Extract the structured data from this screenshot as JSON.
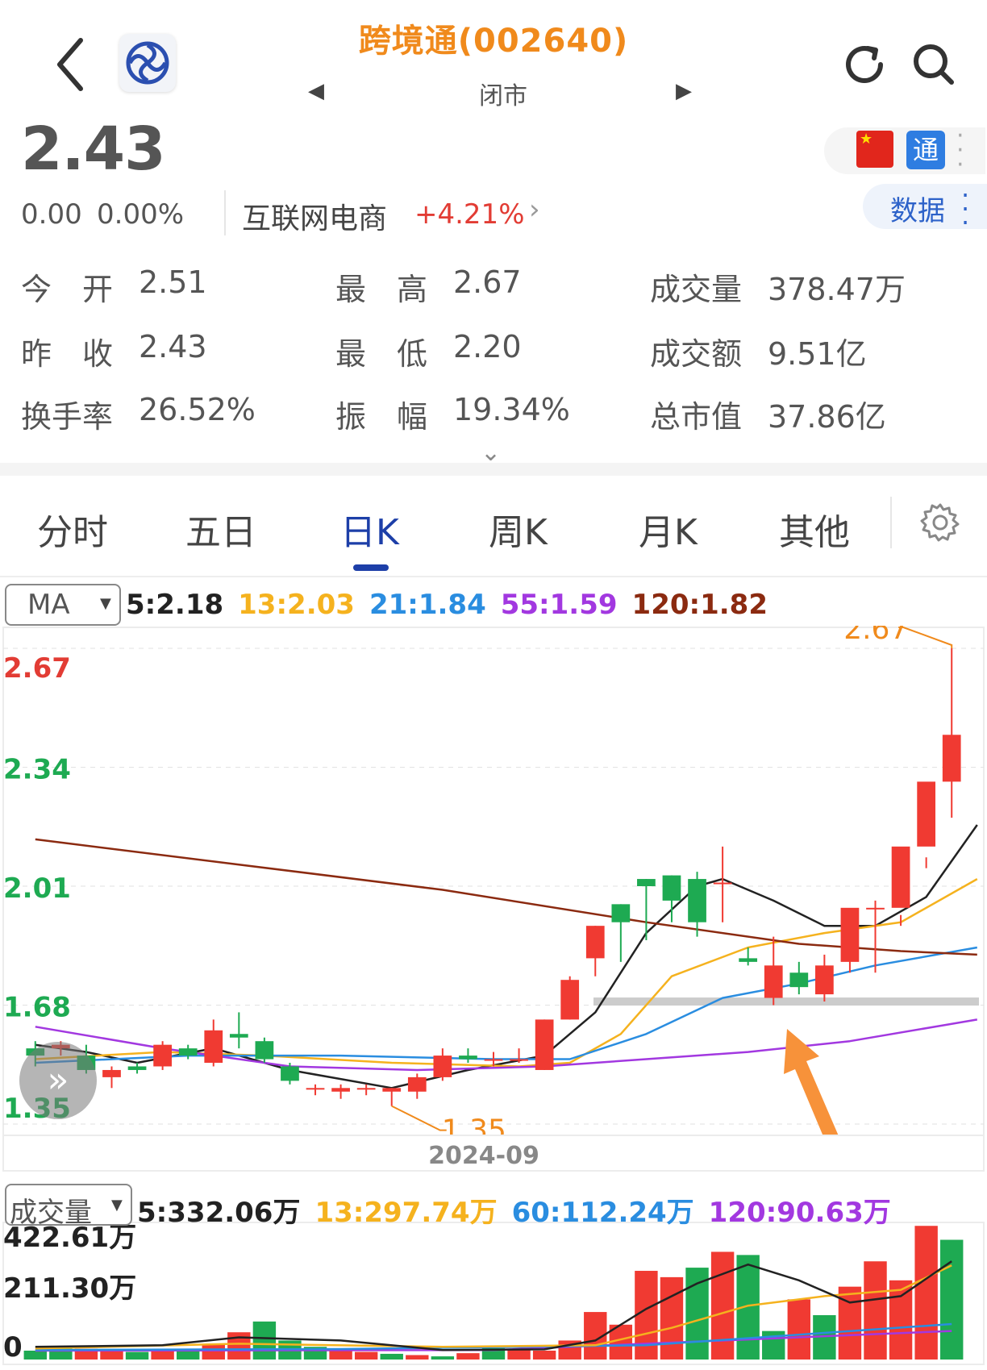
{
  "header": {
    "title": "跨境通(002640)",
    "status": "闭市",
    "prev_glyph": "◀",
    "next_glyph": "▶"
  },
  "quote": {
    "price": "2.43",
    "change": "0.00",
    "change_pct": "0.00%",
    "industry": "互联网电商",
    "industry_pct": "+4.21%",
    "industry_arrow": "›",
    "tong_badge": "通",
    "data_label": "数据"
  },
  "stats": [
    {
      "label": "今　开",
      "value": "2.51"
    },
    {
      "label": "最　高",
      "value": "2.67"
    },
    {
      "label": "成交量",
      "value": "378.47万"
    },
    {
      "label": "昨　收",
      "value": "2.43"
    },
    {
      "label": "最　低",
      "value": "2.20"
    },
    {
      "label": "成交额",
      "value": "9.51亿"
    },
    {
      "label": "换手率",
      "value": "26.52%"
    },
    {
      "label": "振　幅",
      "value": "19.34%"
    },
    {
      "label": "总市值",
      "value": "37.86亿"
    }
  ],
  "tabs": [
    "分时",
    "五日",
    "日K",
    "周K",
    "月K",
    "其他"
  ],
  "active_tab": "日K",
  "ma": {
    "select_label": "MA",
    "values": [
      {
        "text": "5:2.18",
        "color": "#222222"
      },
      {
        "text": "13:2.03",
        "color": "#f5b21e"
      },
      {
        "text": "21:1.84",
        "color": "#2a8de0"
      },
      {
        "text": "55:1.59",
        "color": "#a238e0"
      },
      {
        "text": "120:1.82",
        "color": "#8b2a10"
      }
    ]
  },
  "volume_row": {
    "select_label": "成交量",
    "values": [
      {
        "text": "5:332.06万",
        "color": "#222222"
      },
      {
        "text": "13:297.74万",
        "color": "#f5b21e"
      },
      {
        "text": "60:112.24万",
        "color": "#2a8de0"
      },
      {
        "text": "120:90.63万",
        "color": "#a238e0"
      }
    ]
  },
  "colors": {
    "up": "#f03a32",
    "down": "#1eaa52",
    "accent": "#1d3fa8",
    "title": "#f08a1c"
  },
  "chart_data": {
    "type": "candlestick",
    "y_ticks": [
      "2.67",
      "2.34",
      "2.01",
      "1.68",
      "1.35"
    ],
    "y_tick_colors": [
      "#e23c34",
      "#1eaa52",
      "#1eaa52",
      "#1eaa52",
      "#1eaa52"
    ],
    "ylim": [
      1.35,
      2.67
    ],
    "x_label": "2024-09",
    "max_label": "2.67",
    "min_label": "1.35",
    "candles": [
      {
        "o": 1.56,
        "h": 1.58,
        "l": 1.51,
        "c": 1.54
      },
      {
        "o": 1.56,
        "h": 1.58,
        "l": 1.54,
        "c": 1.57
      },
      {
        "o": 1.54,
        "h": 1.57,
        "l": 1.49,
        "c": 1.5
      },
      {
        "o": 1.48,
        "h": 1.51,
        "l": 1.45,
        "c": 1.5
      },
      {
        "o": 1.51,
        "h": 1.52,
        "l": 1.49,
        "c": 1.5
      },
      {
        "o": 1.51,
        "h": 1.58,
        "l": 1.5,
        "c": 1.57
      },
      {
        "o": 1.56,
        "h": 1.57,
        "l": 1.53,
        "c": 1.54
      },
      {
        "o": 1.52,
        "h": 1.64,
        "l": 1.51,
        "c": 1.61
      },
      {
        "o": 1.6,
        "h": 1.66,
        "l": 1.56,
        "c": 1.59
      },
      {
        "o": 1.58,
        "h": 1.59,
        "l": 1.52,
        "c": 1.53
      },
      {
        "o": 1.51,
        "h": 1.52,
        "l": 1.46,
        "c": 1.47
      },
      {
        "o": 1.45,
        "h": 1.46,
        "l": 1.43,
        "c": 1.45
      },
      {
        "o": 1.44,
        "h": 1.46,
        "l": 1.42,
        "c": 1.45
      },
      {
        "o": 1.45,
        "h": 1.46,
        "l": 1.43,
        "c": 1.45
      },
      {
        "o": 1.44,
        "h": 1.45,
        "l": 1.4,
        "c": 1.45
      },
      {
        "o": 1.44,
        "h": 1.49,
        "l": 1.42,
        "c": 1.48
      },
      {
        "o": 1.48,
        "h": 1.56,
        "l": 1.47,
        "c": 1.54
      },
      {
        "o": 1.54,
        "h": 1.56,
        "l": 1.52,
        "c": 1.53
      },
      {
        "o": 1.53,
        "h": 1.55,
        "l": 1.51,
        "c": 1.53
      },
      {
        "o": 1.53,
        "h": 1.56,
        "l": 1.52,
        "c": 1.53
      },
      {
        "o": 1.5,
        "h": 1.64,
        "l": 1.5,
        "c": 1.64
      },
      {
        "o": 1.64,
        "h": 1.76,
        "l": 1.64,
        "c": 1.75
      },
      {
        "o": 1.81,
        "h": 1.9,
        "l": 1.76,
        "c": 1.9
      },
      {
        "o": 1.96,
        "h": 1.96,
        "l": 1.8,
        "c": 1.91
      },
      {
        "o": 2.03,
        "h": 2.03,
        "l": 1.86,
        "c": 2.01
      },
      {
        "o": 2.04,
        "h": 2.04,
        "l": 1.91,
        "c": 1.97
      },
      {
        "o": 2.03,
        "h": 2.05,
        "l": 1.87,
        "c": 1.91
      },
      {
        "o": 2.02,
        "h": 2.12,
        "l": 1.91,
        "c": 2.02
      },
      {
        "o": 1.81,
        "h": 1.84,
        "l": 1.79,
        "c": 1.8
      },
      {
        "o": 1.7,
        "h": 1.87,
        "l": 1.68,
        "c": 1.79
      },
      {
        "o": 1.77,
        "h": 1.8,
        "l": 1.71,
        "c": 1.73
      },
      {
        "o": 1.71,
        "h": 1.82,
        "l": 1.69,
        "c": 1.79
      },
      {
        "o": 1.8,
        "h": 1.82,
        "l": 1.77,
        "c": 1.95
      },
      {
        "o": 1.95,
        "h": 1.97,
        "l": 1.77,
        "c": 1.95
      },
      {
        "o": 1.95,
        "h": 1.93,
        "l": 1.9,
        "c": 2.12
      },
      {
        "o": 2.12,
        "h": 2.09,
        "l": 2.06,
        "c": 2.3
      },
      {
        "o": 2.3,
        "h": 2.67,
        "l": 2.2,
        "c": 2.43
      }
    ],
    "ma_series": [
      {
        "name": "5",
        "color": "#222222",
        "points": [
          [
            0,
            1.57
          ],
          [
            2,
            1.55
          ],
          [
            4,
            1.52
          ],
          [
            7,
            1.56
          ],
          [
            10,
            1.5
          ],
          [
            14,
            1.45
          ],
          [
            17,
            1.5
          ],
          [
            20,
            1.54
          ],
          [
            22,
            1.66
          ],
          [
            24,
            1.88
          ],
          [
            26,
            2.01
          ],
          [
            27,
            2.03
          ],
          [
            29,
            1.97
          ],
          [
            31,
            1.9
          ],
          [
            33,
            1.9
          ],
          [
            35,
            1.98
          ],
          [
            37,
            2.18
          ]
        ]
      },
      {
        "name": "13",
        "color": "#f5b21e",
        "points": [
          [
            0,
            1.53
          ],
          [
            5,
            1.55
          ],
          [
            9,
            1.54
          ],
          [
            14,
            1.52
          ],
          [
            19,
            1.51
          ],
          [
            21,
            1.52
          ],
          [
            23,
            1.6
          ],
          [
            25,
            1.76
          ],
          [
            28,
            1.84
          ],
          [
            31,
            1.88
          ],
          [
            34,
            1.91
          ],
          [
            37,
            2.03
          ]
        ]
      },
      {
        "name": "21",
        "color": "#2a8de0",
        "points": [
          [
            0,
            1.52
          ],
          [
            6,
            1.54
          ],
          [
            12,
            1.54
          ],
          [
            18,
            1.53
          ],
          [
            21,
            1.53
          ],
          [
            24,
            1.6
          ],
          [
            27,
            1.7
          ],
          [
            30,
            1.74
          ],
          [
            33,
            1.79
          ],
          [
            37,
            1.84
          ]
        ]
      },
      {
        "name": "55",
        "color": "#a238e0",
        "points": [
          [
            0,
            1.62
          ],
          [
            5,
            1.56
          ],
          [
            10,
            1.51
          ],
          [
            15,
            1.5
          ],
          [
            20,
            1.51
          ],
          [
            24,
            1.53
          ],
          [
            28,
            1.55
          ],
          [
            32,
            1.58
          ],
          [
            37,
            1.64
          ]
        ]
      },
      {
        "name": "120",
        "color": "#8b2a10",
        "points": [
          [
            0,
            2.14
          ],
          [
            8,
            2.07
          ],
          [
            16,
            2.0
          ],
          [
            24,
            1.91
          ],
          [
            30,
            1.85
          ],
          [
            34,
            1.83
          ],
          [
            37,
            1.82
          ]
        ]
      }
    ],
    "support_level": 1.69,
    "volume": {
      "y_ticks": [
        "422.61万",
        "211.30万",
        "0"
      ],
      "max": 422.61,
      "values": [
        {
          "v": 28,
          "up": false
        },
        {
          "v": 36,
          "up": false
        },
        {
          "v": 34,
          "up": true
        },
        {
          "v": 28,
          "up": true
        },
        {
          "v": 24,
          "up": false
        },
        {
          "v": 26,
          "up": true
        },
        {
          "v": 30,
          "up": false
        },
        {
          "v": 48,
          "up": true
        },
        {
          "v": 86,
          "up": true
        },
        {
          "v": 120,
          "up": false
        },
        {
          "v": 60,
          "up": false
        },
        {
          "v": 40,
          "up": false
        },
        {
          "v": 28,
          "up": true
        },
        {
          "v": 24,
          "up": true
        },
        {
          "v": 18,
          "up": false
        },
        {
          "v": 14,
          "up": true
        },
        {
          "v": 10,
          "up": false
        },
        {
          "v": 20,
          "up": true
        },
        {
          "v": 36,
          "up": false
        },
        {
          "v": 30,
          "up": true
        },
        {
          "v": 28,
          "up": true
        },
        {
          "v": 60,
          "up": true
        },
        {
          "v": 150,
          "up": true
        },
        {
          "v": 110,
          "up": true
        },
        {
          "v": 280,
          "up": true
        },
        {
          "v": 260,
          "up": true
        },
        {
          "v": 290,
          "up": false
        },
        {
          "v": 340,
          "up": true
        },
        {
          "v": 330,
          "up": false
        },
        {
          "v": 90,
          "up": false
        },
        {
          "v": 190,
          "up": true
        },
        {
          "v": 140,
          "up": false
        },
        {
          "v": 230,
          "up": true
        },
        {
          "v": 310,
          "up": true
        },
        {
          "v": 250,
          "up": true
        },
        {
          "v": 422,
          "up": true
        },
        {
          "v": 378,
          "up": false
        }
      ],
      "ma5": [
        [
          0,
          40
        ],
        [
          5,
          45
        ],
        [
          8,
          70
        ],
        [
          12,
          60
        ],
        [
          16,
          30
        ],
        [
          20,
          32
        ],
        [
          22,
          60
        ],
        [
          24,
          160
        ],
        [
          26,
          240
        ],
        [
          28,
          300
        ],
        [
          30,
          250
        ],
        [
          32,
          180
        ],
        [
          34,
          200
        ],
        [
          36,
          310
        ]
      ],
      "ma13": [
        [
          0,
          35
        ],
        [
          8,
          50
        ],
        [
          16,
          40
        ],
        [
          22,
          45
        ],
        [
          25,
          100
        ],
        [
          28,
          170
        ],
        [
          31,
          200
        ],
        [
          34,
          220
        ],
        [
          36,
          297
        ]
      ],
      "ma60": [
        [
          0,
          30
        ],
        [
          12,
          33
        ],
        [
          24,
          45
        ],
        [
          36,
          112
        ]
      ],
      "ma120": [
        [
          0,
          28
        ],
        [
          18,
          30
        ],
        [
          36,
          90
        ]
      ]
    }
  }
}
